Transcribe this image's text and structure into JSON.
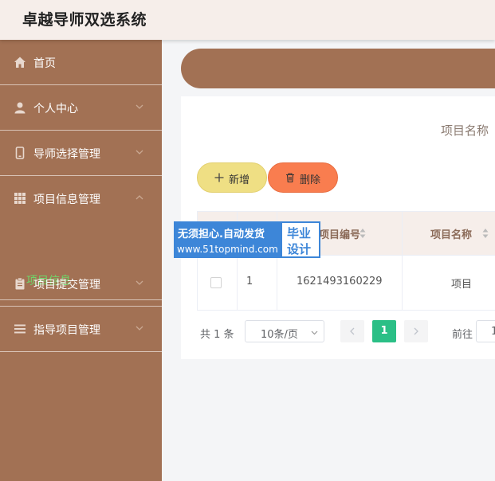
{
  "app": {
    "title": "卓越导师双选系统"
  },
  "sidebar": {
    "items": [
      {
        "label": "首页",
        "icon": "home-icon"
      },
      {
        "label": "个人中心",
        "icon": "user-icon"
      },
      {
        "label": "导师选择管理",
        "icon": "mobile-icon"
      },
      {
        "label": "项目信息管理",
        "icon": "grid-icon",
        "expanded": true
      },
      {
        "label": "项目提交管理",
        "icon": "clipboard-icon"
      },
      {
        "label": "指导项目管理",
        "icon": "list-icon"
      }
    ],
    "sub_item": {
      "label": "项目信息",
      "active": true
    }
  },
  "search": {
    "label": "项目名称"
  },
  "toolbar": {
    "add_label": "新增",
    "delete_label": "删除"
  },
  "table": {
    "columns": [
      "项目编号",
      "项目名称"
    ],
    "rows": [
      {
        "index": "1",
        "project_no": "1621493160229",
        "project_name": "项目"
      }
    ]
  },
  "pagination": {
    "total": "共 1 条",
    "page_size": "10条/页",
    "current_page": "1",
    "goto_label": "前往",
    "goto_value": "1"
  },
  "watermark": {
    "line1": "无须担心.自动发货",
    "line2": "www.51topmind.com",
    "badge1": "毕业",
    "badge2": "设计"
  },
  "colors": {
    "sidebar": "#a27154",
    "header": "#f6eeea",
    "add_button": "#efdf84",
    "delete_button": "#f97d4f",
    "active_page": "#2bbf86",
    "active_sub_item": "#6ed76a"
  }
}
